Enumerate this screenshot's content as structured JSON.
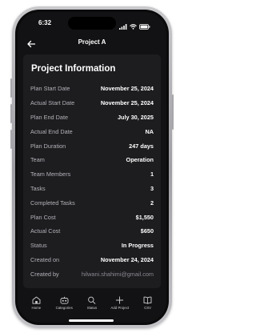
{
  "status_bar": {
    "time": "6:32",
    "icons": [
      "signal-icon",
      "wifi-icon",
      "battery-icon"
    ]
  },
  "header": {
    "title": "Project A",
    "back_icon": "arrow-left-icon"
  },
  "card": {
    "title": "Project Information",
    "rows": [
      {
        "label": "Plan Start Date",
        "value": "November 25, 2024"
      },
      {
        "label": "Actual Start Date",
        "value": "November 25, 2024"
      },
      {
        "label": "Plan End Date",
        "value": "July 30, 2025"
      },
      {
        "label": "Actual End Date",
        "value": "NA"
      },
      {
        "label": "Plan Duration",
        "value": "247 days"
      },
      {
        "label": "Team",
        "value": "Operation"
      },
      {
        "label": "Team Members",
        "value": "1"
      },
      {
        "label": "Tasks",
        "value": "3"
      },
      {
        "label": "Completed Tasks",
        "value": "2"
      },
      {
        "label": "Plan Cost",
        "value": "$1,550"
      },
      {
        "label": "Actual Cost",
        "value": "$650"
      },
      {
        "label": "Status",
        "value": "In Progress"
      },
      {
        "label": "Created on",
        "value": "November 24, 2024"
      },
      {
        "label": "Created by",
        "value": "hilwani.shahimi@gmail.com"
      }
    ]
  },
  "tabbar": {
    "tabs": [
      {
        "label": "Home",
        "icon": "home-icon"
      },
      {
        "label": "Categories",
        "icon": "categories-icon"
      },
      {
        "label": "Status",
        "icon": "search-icon"
      },
      {
        "label": "Add Project",
        "icon": "plus-icon"
      },
      {
        "label": "CSV",
        "icon": "book-icon"
      }
    ]
  },
  "colors": {
    "screen_bg": "#121214",
    "card_bg": "#1d1d20",
    "label": "#b3b3b8",
    "value": "#ffffff",
    "muted_value": "#8a8a90"
  }
}
